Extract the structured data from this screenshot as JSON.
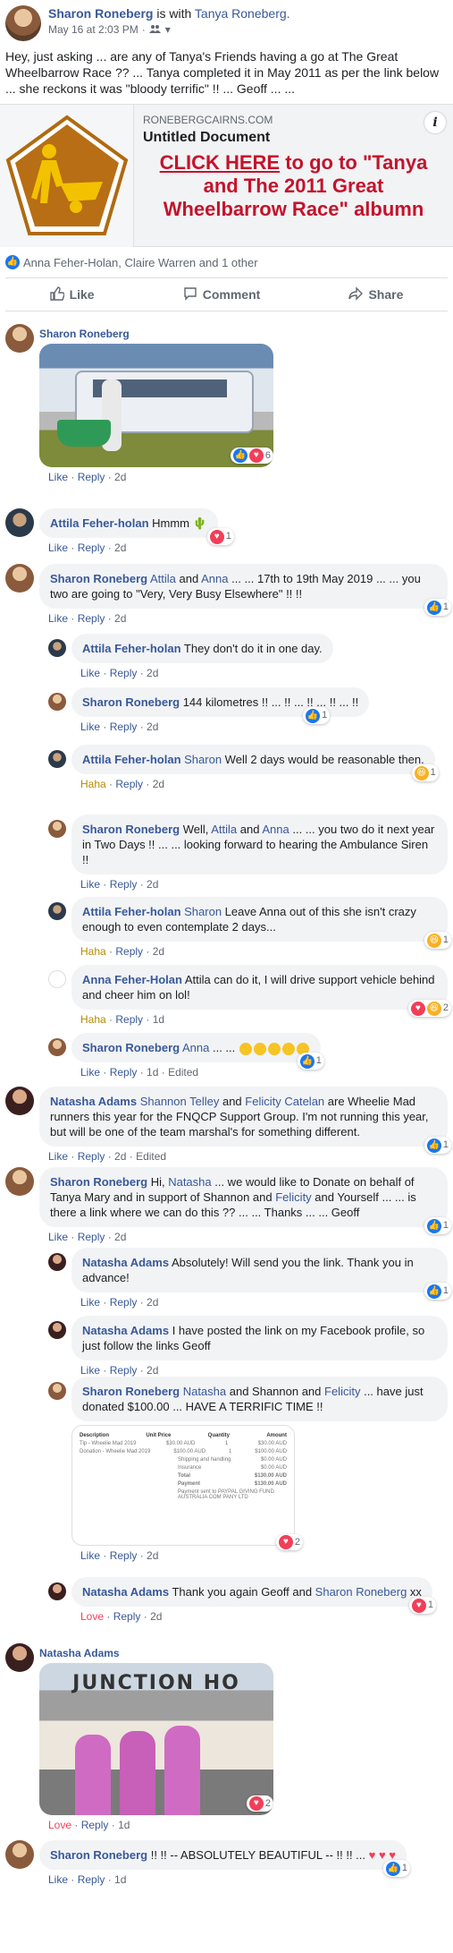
{
  "post": {
    "author": "Sharon Roneberg",
    "with_text": "is with",
    "tagged": "Tanya Roneberg.",
    "timestamp": "May 16 at 2:03 PM",
    "audience_icon": "friends-icon",
    "text": "Hey, just asking ... are any of Tanya's Friends having a go at The Great Wheelbarrow Race ?? ... Tanya completed it in May 2011 as per the link below ... she reckons it was \"bloody terrific\" !! ... Geoff ... ..."
  },
  "link_preview": {
    "domain": "RONEBERGCAIRNS.COM",
    "title": "Untitled Document",
    "cta_link": "CLICK HERE",
    "cta_rest": " to go to \"Tanya and The 2011 Great Wheelbarrow Race\" albumn",
    "info": "i"
  },
  "reactions": {
    "text": "Anna Feher-Holan, Claire Warren and 1 other"
  },
  "actions": {
    "like": "Like",
    "comment": "Comment",
    "share": "Share"
  },
  "comments": [
    {
      "author": "Sharon Roneberg",
      "text": "",
      "actions": [
        "Like",
        "Reply",
        "2d"
      ],
      "react_count": "6"
    },
    {
      "author": "Attila Feher-holan",
      "text": "Hmmm",
      "actions": [
        "Like",
        "Reply",
        "2d"
      ],
      "react_count": "1"
    },
    {
      "author": "Sharon Roneberg",
      "mentions": [
        "Attila",
        "Anna"
      ],
      "text_a": " and ",
      "text_b": " ... ... 17th to 19th May 2019 ... ... you two are going to \"Very, Very Busy Elsewhere\" !! !!",
      "actions": [
        "Like",
        "Reply",
        "2d"
      ],
      "react_count": "1"
    },
    {
      "author": "Attila Feher-holan",
      "text": "They don't do it in one day.",
      "actions": [
        "Like",
        "Reply",
        "2d"
      ]
    },
    {
      "author": "Sharon Roneberg",
      "text": "144 kilometres !! ... !! ... !! ... !! ... !!",
      "actions": [
        "Like",
        "Reply",
        "2d"
      ],
      "react_count": "1"
    },
    {
      "author": "Attila Feher-holan",
      "mention": "Sharon",
      "text": " Well 2 days would be reasonable then.",
      "actions": [
        "Haha",
        "Reply",
        "2d"
      ],
      "react_count": "1"
    },
    {
      "author": "Sharon Roneberg",
      "mentions": [
        "Attila",
        "Anna"
      ],
      "text_a": "Well, ",
      "text_b": " and ",
      "text_c": " ... ... you two do it next year in Two Days !! ... ... looking forward to hearing the Ambulance Siren !!",
      "actions": [
        "Like",
        "Reply",
        "2d"
      ]
    },
    {
      "author": "Attila Feher-holan",
      "mention": "Sharon",
      "text": " Leave Anna out of this she isn't crazy enough to even contemplate 2 days...",
      "actions": [
        "Haha",
        "Reply",
        "2d"
      ],
      "react_count": "1"
    },
    {
      "author": "Anna Feher-Holan",
      "text": "Attila can do it, I will drive support vehicle behind and cheer him on lol!",
      "actions": [
        "Haha",
        "Reply",
        "1d"
      ],
      "react_count": "2"
    },
    {
      "author": "Sharon Roneberg",
      "mention": "Anna",
      "text": " ... ...",
      "actions": [
        "Like",
        "Reply",
        "1d",
        "Edited"
      ],
      "react_count": "1"
    },
    {
      "author": "Natasha Adams",
      "mentions": [
        "Shannon Telley",
        "Felicity Catelan"
      ],
      "text_a": " and ",
      "text_b": " are Wheelie Mad runners this year for the FNQCP Support Group. I'm not running this year, but will be one of the team marshal's for something different.",
      "actions": [
        "Like",
        "Reply",
        "2d",
        "Edited"
      ],
      "react_count": "1"
    },
    {
      "author": "Sharon Roneberg",
      "mentions": [
        "Natasha",
        "Felicity"
      ],
      "text_a": "Hi, ",
      "text_b": " ... we would like to Donate on behalf of Tanya Mary and in support of Shannon and ",
      "text_c": " and Yourself ... ... is there a link where we can do this ?? ... ... Thanks ... ... Geoff",
      "actions": [
        "Like",
        "Reply",
        "2d"
      ],
      "react_count": "1"
    },
    {
      "author": "Natasha Adams",
      "text": "Absolutely! Will send you the link. Thank you in advance!",
      "actions": [
        "Like",
        "Reply",
        "2d"
      ],
      "react_count": "1"
    },
    {
      "author": "Natasha Adams",
      "text": "I have posted the link on my Facebook profile, so just follow the links Geoff",
      "actions": [
        "Like",
        "Reply",
        "2d"
      ]
    },
    {
      "author": "Sharon Roneberg",
      "mentions": [
        "Natasha",
        "Felicity"
      ],
      "text_a": " and Shannon and ",
      "text_b": " ... have just donated $100.00 ... HAVE A TERRIFIC TIME !!",
      "actions": [
        "Like",
        "Reply",
        "2d"
      ],
      "react_count": "2"
    },
    {
      "author": "Natasha Adams",
      "mention": "Sharon Roneberg",
      "text_a": "Thank you again Geoff and ",
      "text_b": " xx",
      "actions": [
        "Love",
        "Reply",
        "2d"
      ],
      "react_count": "1"
    },
    {
      "author": "Natasha Adams",
      "photo_caption": "JUNCTION HO",
      "actions": [
        "Love",
        "Reply",
        "1d"
      ],
      "react_count": "2"
    },
    {
      "author": "Sharon Roneberg",
      "text": "!! !! -- ABSOLUTELY BEAUTIFUL -- !! !! ...",
      "actions": [
        "Like",
        "Reply",
        "1d"
      ],
      "react_count": "1"
    }
  ],
  "receipt": {
    "h1": "Description",
    "h2": "Unit Price",
    "h3": "Quantity",
    "h4": "Amount",
    "r1": "Tip - Wheelie Mad 2019",
    "r1b": "$30.00 AUD",
    "r1c": "1",
    "r1d": "$30.00 AUD",
    "r2": "Donation - Wheelie Mad 2019",
    "r2b": "$100.00 AUD",
    "r2c": "1",
    "r2d": "$100.00 AUD",
    "r3": "Shipping and handling",
    "r3d": "$0.00 AUD",
    "r4": "Insurance",
    "r4d": "$0.00 AUD",
    "r5": "Total",
    "r5d": "$130.00 AUD",
    "r6": "Payment",
    "r6d": "$130.00 AUD",
    "r7": "Payment sent to PAYPAL GIVING FUND AUSTRALIA COM PANY LTD"
  },
  "colors": {
    "link": "#385898",
    "cta": "#c4132b",
    "like": "#1877f2",
    "love": "#f33e58",
    "haha": "#f7b125",
    "bubble": "#f2f3f5"
  }
}
